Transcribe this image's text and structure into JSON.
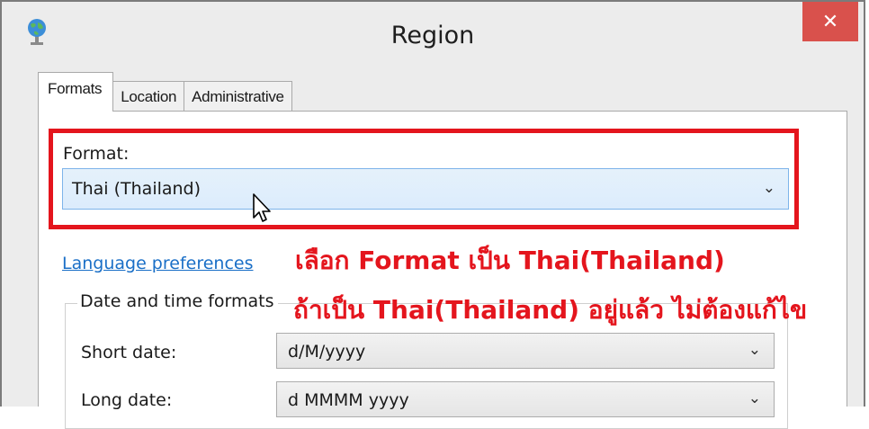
{
  "window": {
    "title": "Region",
    "close_glyph": "✕",
    "app_icon": "globe-icon"
  },
  "tabs": [
    {
      "label": "Formats",
      "active": true
    },
    {
      "label": "Location",
      "active": false
    },
    {
      "label": "Administrative",
      "active": false
    }
  ],
  "format": {
    "label": "Format:",
    "value": "Thai (Thailand)"
  },
  "language_link": "Language preferences",
  "annotations": {
    "line1": "เลือก Format เป็น Thai(Thailand)",
    "line2": "ถ้าเป็น Thai(Thailand)  อยู่แล้ว ไม่ต้องแก้ไข",
    "color": "#e4151d"
  },
  "date_time": {
    "group_title": "Date and time formats",
    "rows": [
      {
        "label": "Short date:",
        "value": "d/M/yyyy"
      },
      {
        "label": "Long date:",
        "value": "d MMMM yyyy"
      }
    ]
  },
  "colors": {
    "accent": "#7eb4ea",
    "close": "#d9514c",
    "link": "#1a6fc7"
  }
}
